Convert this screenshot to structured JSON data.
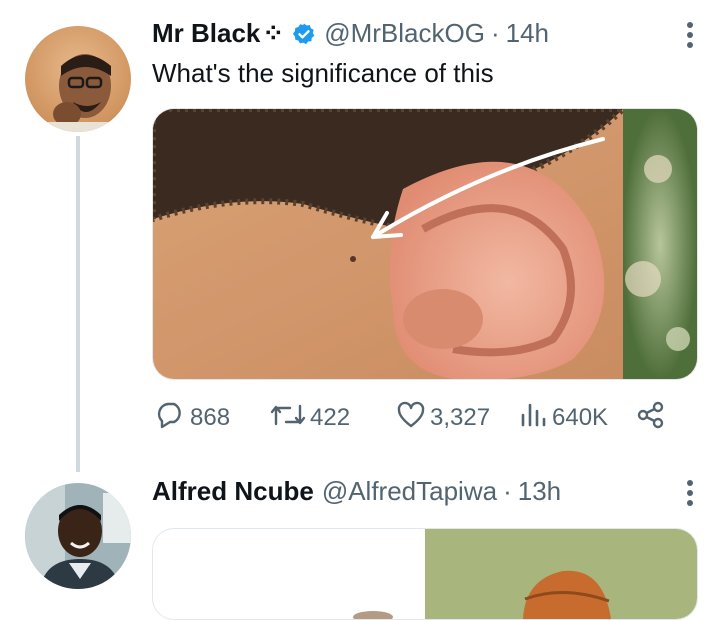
{
  "tweet1": {
    "name": "Mr Black",
    "name_symbol": "⁘",
    "handle": "@MrBlackOG",
    "separator": "·",
    "time": "14h",
    "text": "What's the significance of this",
    "avatar": "profile-photo-man-glasses",
    "media": "ear-preauricular-pit-photo",
    "verified_color": "#1d9bf0",
    "stats": {
      "replies": "868",
      "retweets": "422",
      "likes": "3,327",
      "views": "640K"
    }
  },
  "tweet2": {
    "name": "Alfred Ncube",
    "handle": "@AlfredTapiwa",
    "separator": "·",
    "time": "13h",
    "avatar": "profile-photo-man-smiling",
    "media": "illustration-cartoon"
  },
  "icons": [
    "verified-badge-icon",
    "more-icon",
    "reply-icon",
    "retweet-icon",
    "like-icon",
    "views-icon",
    "share-icon"
  ]
}
